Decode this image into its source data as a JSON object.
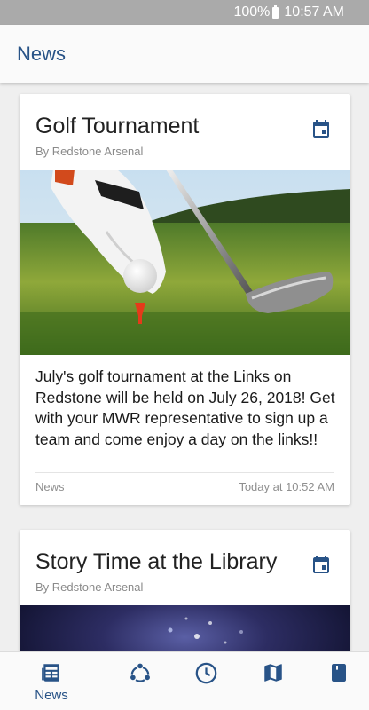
{
  "status_bar": {
    "battery": "100%",
    "time": "10:57 AM"
  },
  "header": {
    "title": "News"
  },
  "cards": [
    {
      "title": "Golf Tournament",
      "author": "By Redstone Arsenal",
      "body": "July's golf tournament at the Links on Redstone will be held on July 26, 2018! Get with your MWR representative to sign up a team and come enjoy a day on the links!!",
      "category": "News",
      "timestamp": "Today at 10:52 AM",
      "icon": "calendar-icon"
    },
    {
      "title": "Story Time at the Library",
      "author": "By Redstone Arsenal",
      "icon": "calendar-icon"
    }
  ],
  "bottom_nav": [
    {
      "label": "News",
      "icon": "newspaper-icon",
      "active": true
    },
    {
      "label": "",
      "icon": "community-icon"
    },
    {
      "label": "",
      "icon": "clock-icon"
    },
    {
      "label": "",
      "icon": "map-icon"
    },
    {
      "label": "",
      "icon": "book-icon"
    }
  ],
  "colors": {
    "accent": "#285387",
    "status_bar": "#aaaaaa",
    "background": "#efefef"
  }
}
